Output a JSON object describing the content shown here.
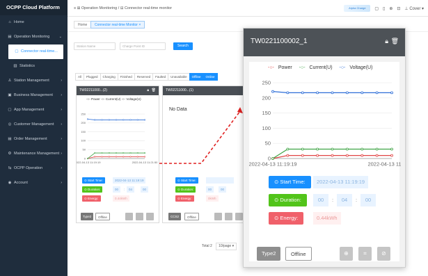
{
  "app_title": "OCPP Cloud Platform",
  "sidebar": {
    "items": [
      {
        "icon": "home-icon",
        "label": "Home",
        "glyph": "⌂"
      },
      {
        "icon": "monitor-icon",
        "label": "Operation Monitoring",
        "glyph": "▤",
        "arrow": "⌄"
      },
      {
        "icon": "plug-icon",
        "label": "Connector real-time...",
        "glyph": "▢",
        "active": true
      },
      {
        "icon": "stats-icon",
        "label": "Statistics",
        "glyph": "▥"
      },
      {
        "icon": "station-icon",
        "label": "Station Management",
        "glyph": "♙",
        "arrow": "›"
      },
      {
        "icon": "business-icon",
        "label": "Business Management",
        "glyph": "▣",
        "arrow": "›"
      },
      {
        "icon": "app-icon",
        "label": "App Management",
        "glyph": "▢",
        "arrow": "›"
      },
      {
        "icon": "customer-icon",
        "label": "Customer Management",
        "glyph": "◎",
        "arrow": "›"
      },
      {
        "icon": "order-icon",
        "label": "Order Management",
        "glyph": "▤",
        "arrow": "›"
      },
      {
        "icon": "maintenance-icon",
        "label": "Maintenance Management",
        "glyph": "⚙",
        "arrow": "›"
      },
      {
        "icon": "ocpp-icon",
        "label": "OCPP Operation",
        "glyph": "⇆",
        "arrow": "›"
      },
      {
        "icon": "account-icon",
        "label": "Account",
        "glyph": "◉",
        "arrow": "›"
      }
    ]
  },
  "header": {
    "breadcrumb": "≡  ⊞ Operation Monitoring  /  ⊟ Connector real-time monitor",
    "logo_text": "Alpha Charge",
    "icons": [
      "▢",
      "▯",
      "⊕",
      "⊡"
    ],
    "user": "⊥  Cover ▾"
  },
  "tabs": [
    {
      "label": "Home",
      "active": false
    },
    {
      "label": "Connector real-time Monitor ×",
      "active": true
    }
  ],
  "filters": {
    "station_placeholder": "Station Name",
    "point_placeholder": "Charge Point ID",
    "search_label": "Search"
  },
  "status_filters": [
    "All",
    "Plugged",
    "Charging",
    "Finished",
    "Reserved",
    "Faulted",
    "Unavailable",
    "Offline",
    "Online"
  ],
  "small_cards": [
    {
      "id": "TW02211000...(2)",
      "legend": "-○- Power  -○- Current(U)  -○- Voltage(U)",
      "y_ticks": [
        "250",
        "200",
        "150",
        "100",
        "50",
        "0"
      ],
      "x_ticks": [
        "2022-04-13 11:19:19",
        "2022-04-13 11:21:50"
      ],
      "start_label": "⊙ Start Time:",
      "start_value": "2022-04-13 11:19:19",
      "duration_label": "⊙ Duration:",
      "duration_value": [
        "00",
        ":",
        "04",
        ":",
        "00"
      ],
      "energy_label": "⊙ Energy:",
      "energy_value": "0.44kWh",
      "type_label": "Type2",
      "status_label": "Offline"
    },
    {
      "id": "TW02211000...(1)",
      "no_data": "No Data",
      "start_label": "⊙ Start Time:",
      "start_value": "",
      "duration_label": "⊙ Duration:",
      "duration_value": [
        "00",
        ":",
        "00",
        ":",
        "00"
      ],
      "energy_label": "⊙ Energy:",
      "energy_value": "0kWh",
      "type_label": "CCS2",
      "status_label": "Offline"
    }
  ],
  "pager": {
    "total": "Total 2",
    "page_size": "10/page ▾"
  },
  "overlay": {
    "title": "TW0221100002_1",
    "legend": [
      {
        "name": "Power",
        "color": "#e04545"
      },
      {
        "name": "Current(U)",
        "color": "#3fa344"
      },
      {
        "name": "Voltage(U)",
        "color": "#2d6ed8"
      }
    ],
    "start_label": "⊙ Start Time:",
    "start_value": "2022-04-13 11:19:19",
    "duration_label": "⊙ Duration:",
    "duration_h": "00",
    "duration_sep1": ":",
    "duration_m": "04",
    "duration_sep2": ":",
    "duration_s": "00",
    "energy_label": "⊙ Energy:",
    "energy_value": "0.44kWh",
    "type_label": "Type2",
    "status_label": "Offline"
  },
  "chart_data": {
    "type": "line",
    "x": [
      "2022-04-13 11:19:19",
      "",
      "",
      "",
      "",
      "",
      "",
      "",
      "2022-04-13 11:21:50"
    ],
    "x_tick_labels": [
      "2022-04-13 11:19:19",
      "2022-04-13 11:21:50"
    ],
    "series": [
      {
        "name": "Power",
        "color": "#e04545",
        "values": [
          0,
          10,
          10,
          10,
          10,
          10,
          10,
          10,
          10
        ]
      },
      {
        "name": "Current(U)",
        "color": "#3fa344",
        "values": [
          0,
          31,
          31,
          31,
          31,
          31,
          31,
          31,
          31
        ]
      },
      {
        "name": "Voltage(U)",
        "color": "#2d6ed8",
        "values": [
          221,
          217,
          217,
          217,
          217,
          217,
          217,
          217,
          217
        ]
      }
    ],
    "ylim": [
      0,
      250
    ],
    "y_ticks": [
      0,
      50,
      100,
      150,
      200,
      250
    ],
    "grid": true,
    "legend_position": "top"
  },
  "colors": {
    "sidebar_bg": "#1f2d3d",
    "primary": "#1890ff",
    "green": "#52c41a",
    "red": "#f0606a",
    "header_dark": "#4d5257"
  }
}
